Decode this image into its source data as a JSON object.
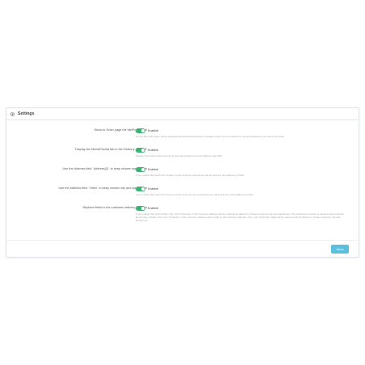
{
  "panel": {
    "title": "Settings",
    "rows": [
      {
        "label": "Show in Order page the MelPoshta tab",
        "state": "Enabled",
        "help": "On the BO order page, will be displayed the MeestPoshta tab to manage returns by the customer's city and warehouse (or parcel terminal)."
      },
      {
        "label": "Display the MeestPoshta tab in the Delivery slip PDF",
        "state": "Enabled",
        "help": "Display information about returns by city and warehouse in the Delivery slip PDF."
      },
      {
        "label": "Use the Address field `Address(2)` to keep chosen warehouse",
        "state": "Enabled",
        "help": "If you enable this option the chosen by the customer warehouse will be saved to the Address (2) field."
      },
      {
        "label": "Use the Address field `Other` to keep chosen city and warehouse",
        "state": "Enabled",
        "help": "If you enable this option the chosen by the customer city and warehouse will be saved to the Address (2) field."
      },
      {
        "label": "Replace fields in the customer delivery address",
        "state": "Enabled",
        "help": "If you enable this option fields `City` and `Postcode` in the customer address will be replaced by data from chosen customer city and warehouse. The warehouse number is saved to the postcode. By the way, if fields `City` and `Postcode` in the customer address above (2D) by the customer data like `City` and `Postcode` fields will be saved as (0) by data from chosen customer city and warehouse."
      }
    ],
    "save_label": "Save"
  },
  "colors": {
    "toggle_on": "#3cb371",
    "save_button": "#5bc0de"
  }
}
